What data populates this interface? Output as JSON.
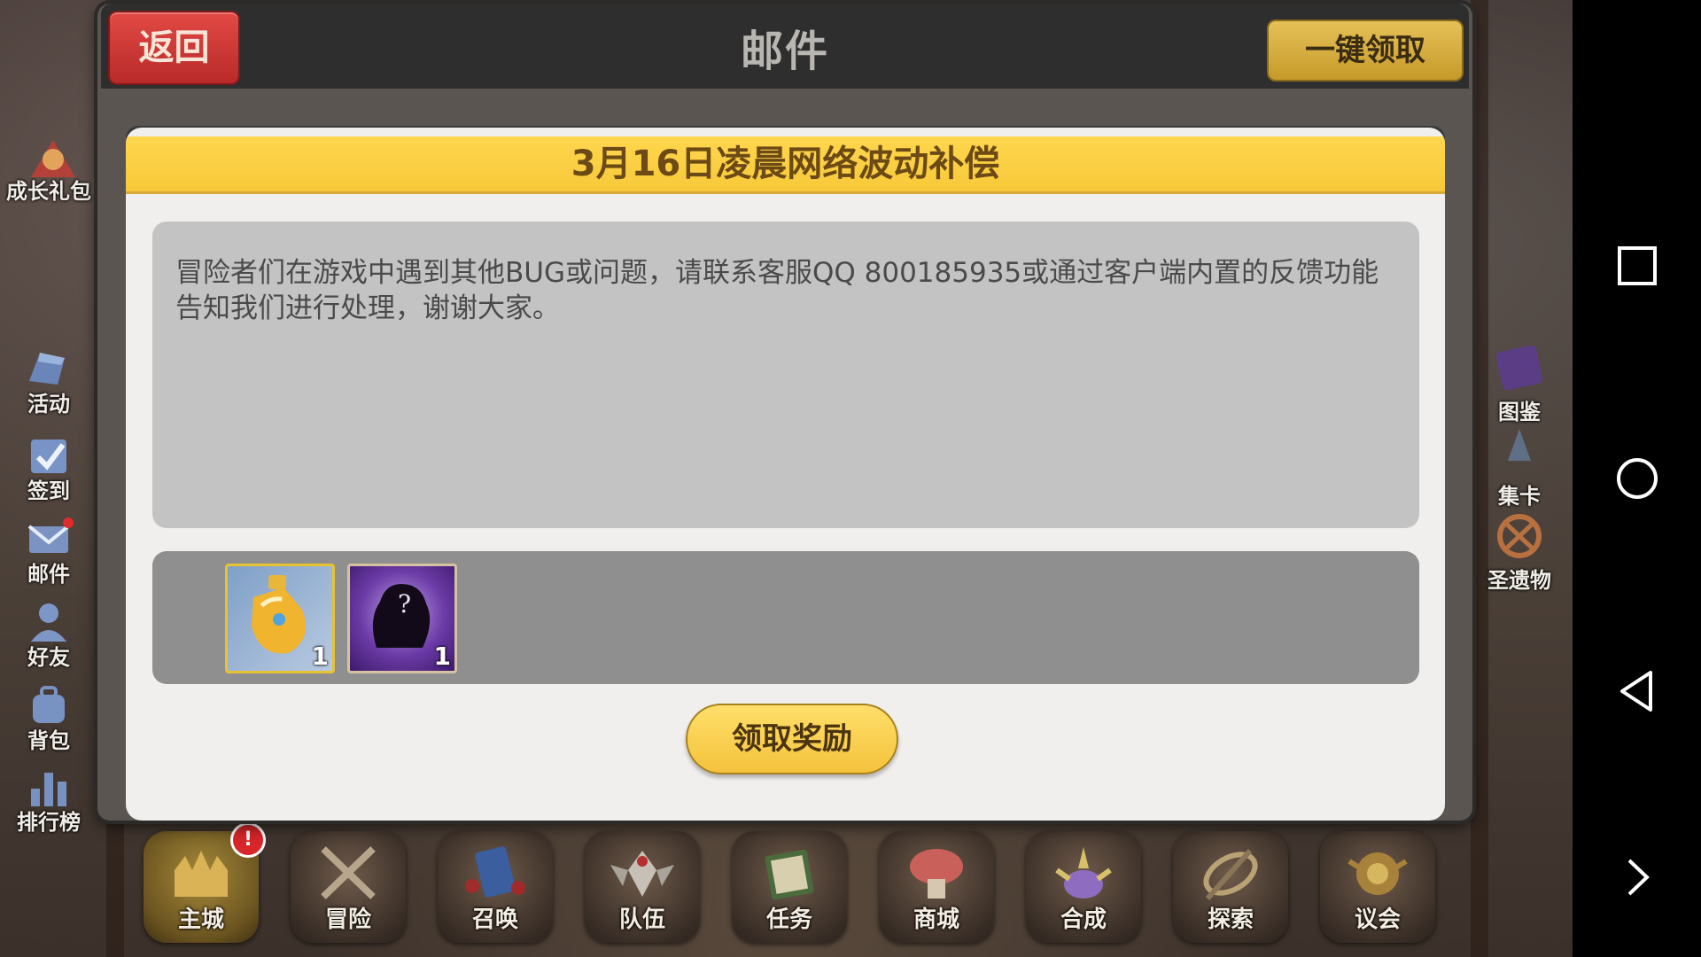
{
  "mail_panel": {
    "back_label": "返回",
    "title": "邮件",
    "claim_all_label": "一键领取",
    "mail": {
      "subject": "3月16日凌晨网络波动补偿",
      "body": "冒险者们在游戏中遇到其他BUG或问题，请联系客服QQ 800185935或通过客户端内置的反馈功能告知我们进行处理，谢谢大家。",
      "attachments": [
        {
          "icon": "golden-potion-icon",
          "quantity": "1"
        },
        {
          "icon": "mystery-hero-silhouette-icon",
          "quantity": "1"
        }
      ],
      "claim_label": "领取奖励"
    }
  },
  "side_menu_left": [
    {
      "label": "成长礼包",
      "icon": "growth-gift-icon"
    },
    {
      "label": "活动",
      "icon": "activity-icon"
    },
    {
      "label": "签到",
      "icon": "check-in-icon"
    },
    {
      "label": "邮件",
      "icon": "mail-icon"
    },
    {
      "label": "好友",
      "icon": "friends-icon"
    },
    {
      "label": "背包",
      "icon": "backpack-icon"
    },
    {
      "label": "排行榜",
      "icon": "leaderboard-icon"
    }
  ],
  "side_menu_right": [
    {
      "label": "图鉴",
      "icon": "codex-icon"
    },
    {
      "label": "集卡",
      "icon": "card-collect-icon"
    },
    {
      "label": "圣遗物",
      "icon": "relic-icon"
    }
  ],
  "bottom_nav": [
    {
      "label": "主城",
      "icon": "main-city-icon",
      "badge": "!"
    },
    {
      "label": "冒险",
      "icon": "adventure-icon"
    },
    {
      "label": "召唤",
      "icon": "summon-icon"
    },
    {
      "label": "队伍",
      "icon": "team-icon"
    },
    {
      "label": "任务",
      "icon": "quest-icon"
    },
    {
      "label": "商城",
      "icon": "shop-icon"
    },
    {
      "label": "合成",
      "icon": "craft-icon"
    },
    {
      "label": "探索",
      "icon": "explore-icon"
    },
    {
      "label": "议会",
      "icon": "council-icon"
    }
  ],
  "colors": {
    "accent_yellow": "#f7c93a",
    "back_red": "#c53532",
    "panel_dark": "#2e2e2e"
  }
}
